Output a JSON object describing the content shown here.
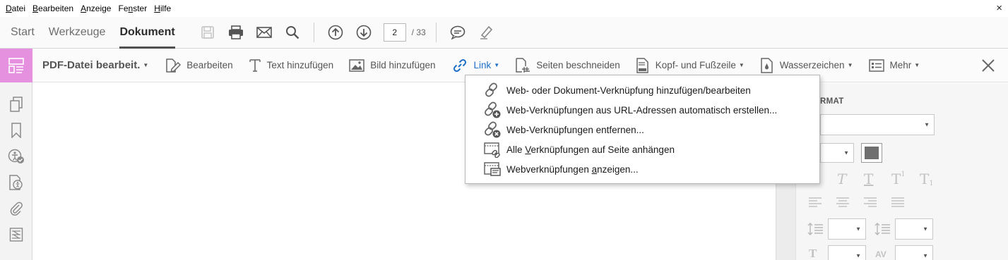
{
  "menubar": {
    "items": [
      {
        "pre": "",
        "key": "D",
        "post": "atei"
      },
      {
        "pre": "",
        "key": "B",
        "post": "earbeiten"
      },
      {
        "pre": "",
        "key": "A",
        "post": "nzeige"
      },
      {
        "pre": "Fe",
        "key": "n",
        "post": "ster"
      },
      {
        "pre": "",
        "key": "H",
        "post": "ilfe"
      }
    ],
    "close_glyph": "×"
  },
  "toolbar": {
    "tabs": [
      "Start",
      "Werkzeuge",
      "Dokument"
    ],
    "active_tab": "Dokument",
    "page_current": "2",
    "page_total": "/ 33"
  },
  "edit_toolbar": {
    "title": "PDF-Datei bearbeit.",
    "tools": {
      "bearbeiten": "Bearbeiten",
      "text": "Text hinzufügen",
      "bild": "Bild hinzufügen",
      "link": "Link",
      "beschneiden": "Seiten beschneiden",
      "kopf": "Kopf- und Fußzeile",
      "wasser": "Wasserzeichen",
      "mehr": "Mehr"
    }
  },
  "link_menu": {
    "item1": {
      "pre": "Web- oder Dokument-Verknüpfung hinzufügen/bearbeiten",
      "key": "",
      "post": ""
    },
    "item2": {
      "pre": "Web-Verknüpfungen aus URL-Adressen automatisch erstellen...",
      "key": "",
      "post": ""
    },
    "item3": {
      "pre": "Web-Verknüpfungen entfernen...",
      "key": "",
      "post": ""
    },
    "item4": {
      "pre": "Alle ",
      "key": "V",
      "post": "erknüpfungen auf Seite anhängen"
    },
    "item5": {
      "pre": "Webverknüpfungen ",
      "key": "a",
      "post": "nzeigen..."
    }
  },
  "right_panel": {
    "heading": "RMAT",
    "text_glyphs": [
      "T",
      "T",
      "T",
      "T"
    ],
    "sup_glyph": "1",
    "sub_glyph": "1",
    "av_label": "AV",
    "t_label": "T"
  },
  "colors": {
    "accent_pink": "#e691e0",
    "link_blue": "#1d6fc7",
    "swatch": "#6f6f6f"
  }
}
